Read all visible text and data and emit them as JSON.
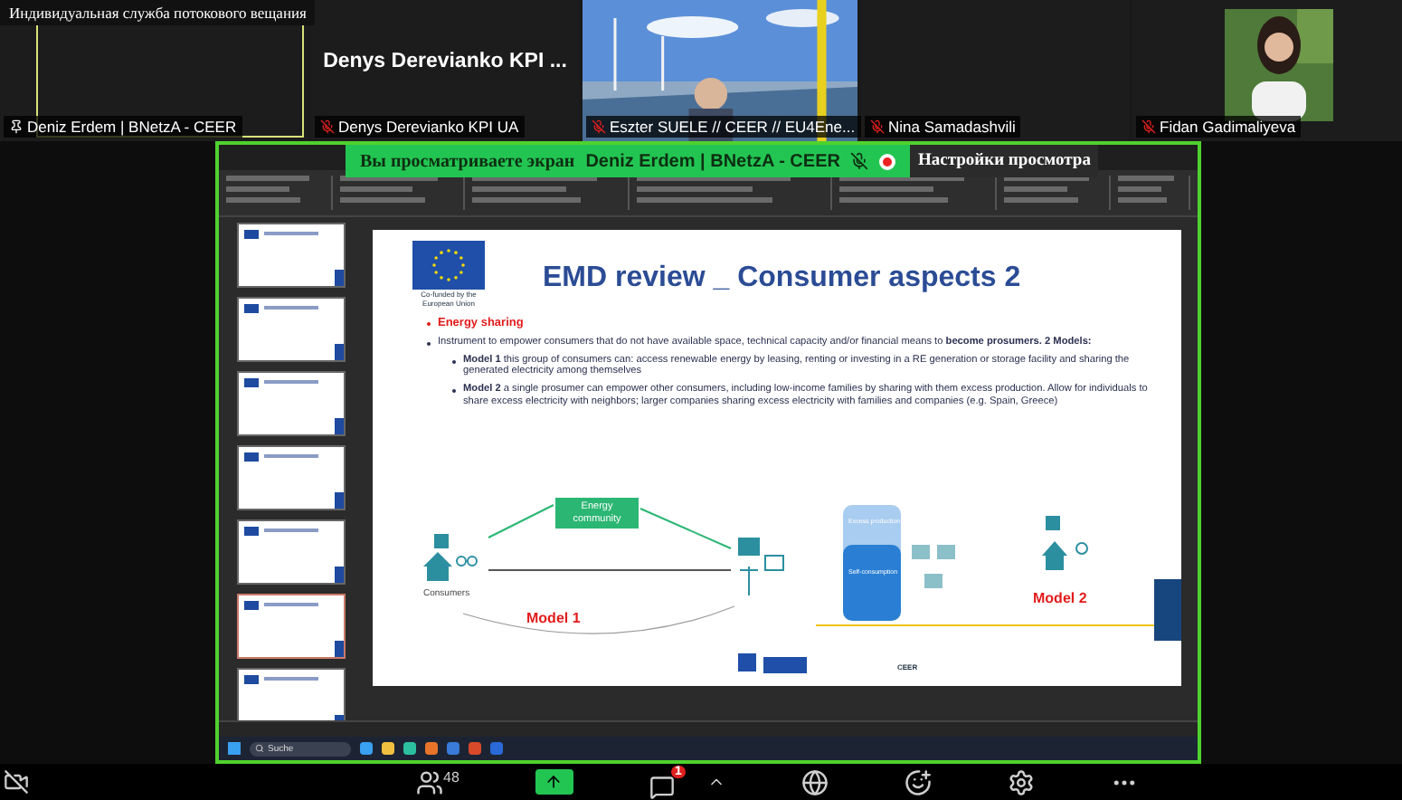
{
  "tiles": [
    {
      "kind": "blank",
      "caption": "Индивидуальная служба потокового вещания",
      "name": "Deniz Erdem | BNetzA - CEER",
      "pinned": true,
      "muted": false,
      "highlighted": true
    },
    {
      "kind": "title",
      "title": "Denys Derevianko KPI ...",
      "name": "Denys Derevianko KPI UA",
      "pinned": false,
      "muted": true,
      "highlighted": false
    },
    {
      "kind": "picture",
      "name": "Eszter SUELE // CEER // EU4Ene...",
      "pinned": false,
      "muted": true,
      "highlighted": false
    },
    {
      "kind": "blank",
      "name": "Nina Samadashvili",
      "pinned": false,
      "muted": true,
      "highlighted": false
    },
    {
      "kind": "picture",
      "name": "Fidan Gadimaliyeva",
      "pinned": false,
      "muted": true,
      "highlighted": false
    }
  ],
  "share_banner": {
    "label": "Вы просматриваете экран",
    "presenter": "Deniz Erdem | BNetzA - CEER",
    "settings": "Настройки просмотра"
  },
  "thumbnails": [
    {
      "selected": false
    },
    {
      "selected": false
    },
    {
      "selected": false
    },
    {
      "selected": false
    },
    {
      "selected": false
    },
    {
      "selected": true
    },
    {
      "selected": false
    }
  ],
  "slide": {
    "eu_label": "Co-funded by the European Union",
    "title": "EMD review _ Consumer aspects 2",
    "bullets": [
      {
        "kind": "heading",
        "text": "Energy sharing"
      },
      {
        "kind": "main",
        "text": "Instrument to empower consumers that do not have available space, technical capacity and/or financial means to **become prosumers. 2 Models:**"
      },
      {
        "kind": "sub",
        "text": "**Model 1** this group of consumers can: access renewable energy by leasing, renting or investing in a RE generation or storage facility and sharing the generated electricity among themselves"
      },
      {
        "kind": "sub",
        "text": "**Model 2** a single prosumer can empower other consumers, including low-income families by sharing with them excess production. Allow for individuals to share excess electricity with  neighbors; larger companies sharing excess electricity with families and companies (e.g. Spain, Greece)"
      }
    ],
    "diagram": {
      "community": "Energy community",
      "consumers": "Consumers",
      "model_1": "Model 1",
      "model_2": "Model 2",
      "excess": "Excess production",
      "self": "Self-consumption",
      "ceer": "CEER"
    }
  },
  "taskbar": {
    "search": "Suche"
  },
  "toolbar": {
    "participants": "48",
    "chat_badge": "1"
  }
}
